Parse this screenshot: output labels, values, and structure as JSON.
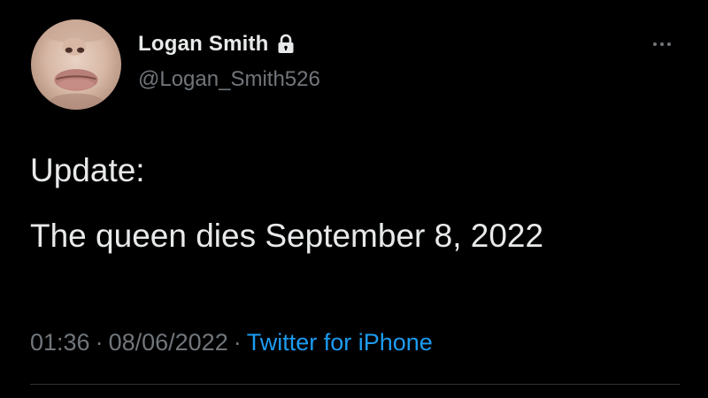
{
  "author": {
    "display_name": "Logan Smith",
    "handle": "@Logan_Smith526",
    "protected_icon": "lock-icon",
    "avatar_icon": "avatar-face-photo"
  },
  "tweet": {
    "lines": [
      "Update:",
      "The queen dies September 8, 2022"
    ]
  },
  "meta": {
    "time": "01:36",
    "separator": "·",
    "date": "08/06/2022",
    "source": "Twitter for iPhone"
  },
  "colors": {
    "background": "#000000",
    "text": "#e7e9ea",
    "secondary": "#71767b",
    "link": "#1d9bf0",
    "divider": "#2f3336"
  }
}
